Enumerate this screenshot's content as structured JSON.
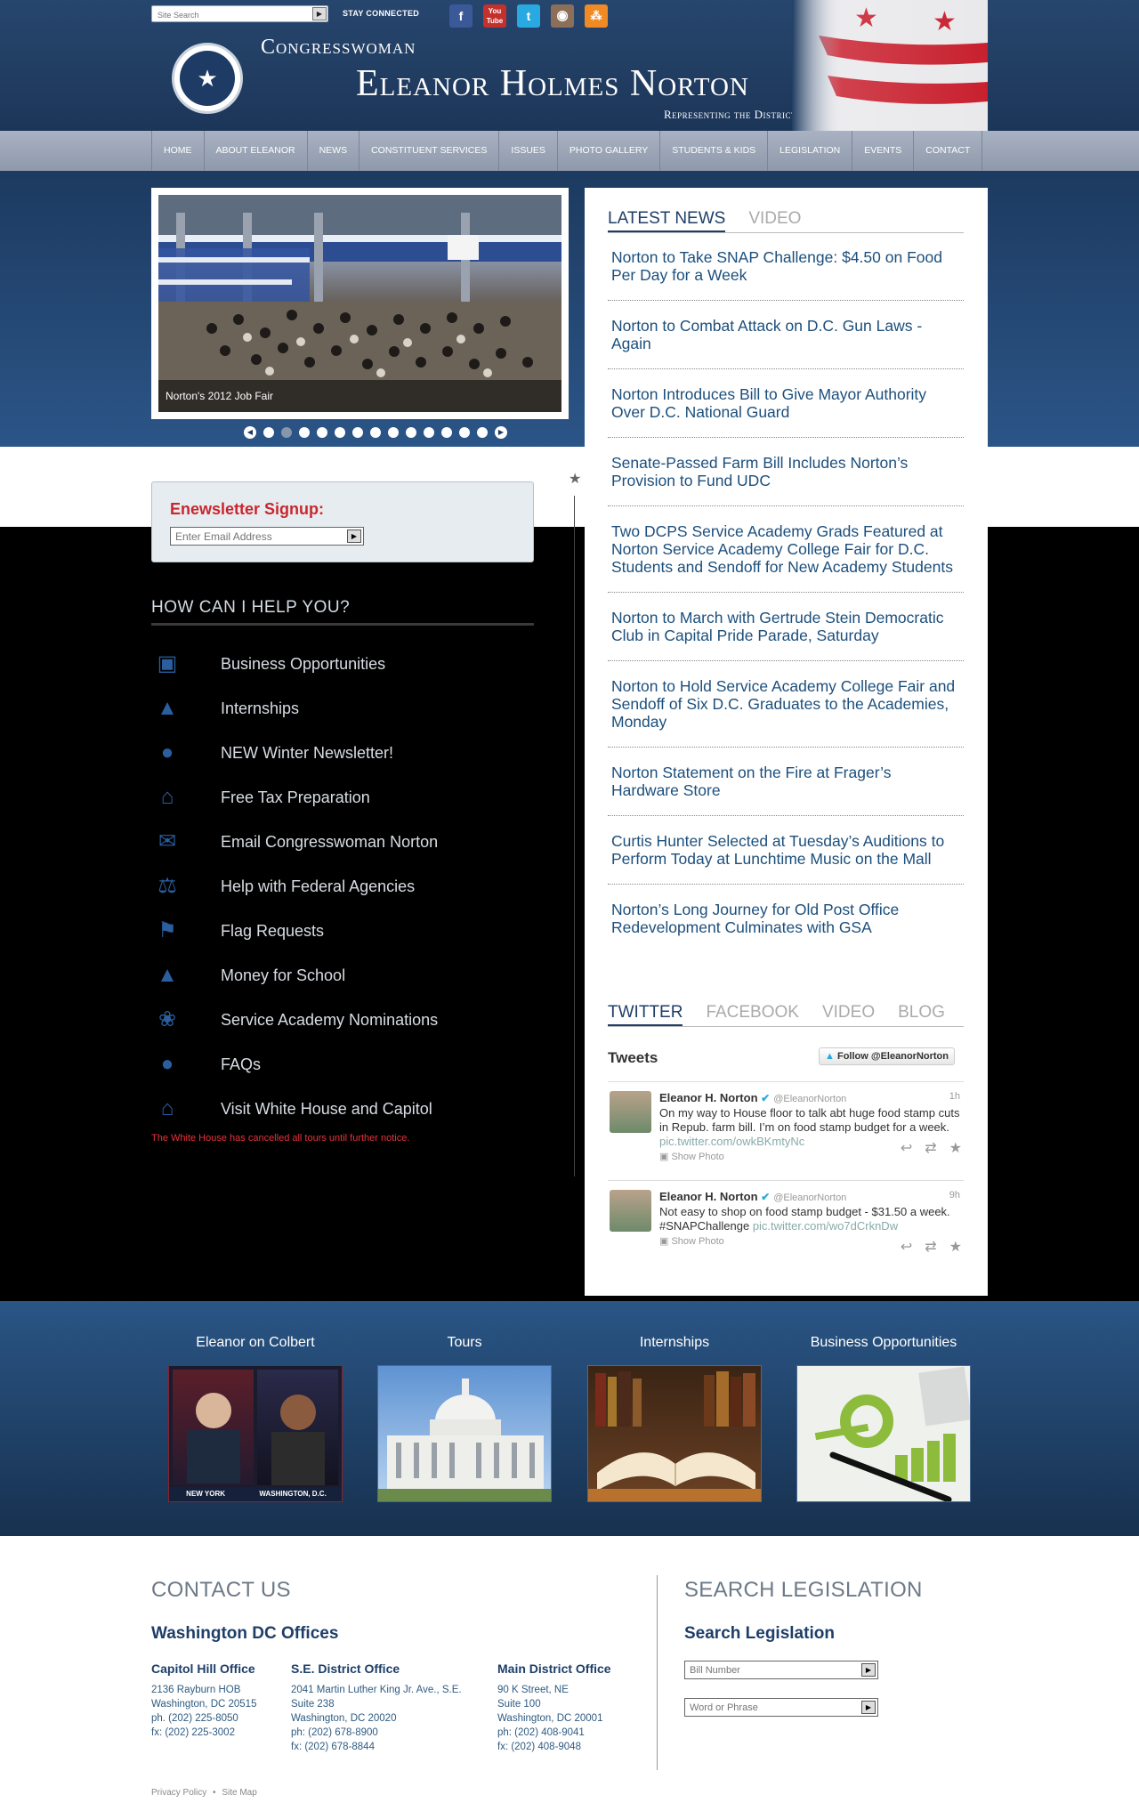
{
  "header": {
    "search_placeholder": "Site Search",
    "stay_connected": "STAY CONNECTED",
    "social_icons": [
      "facebook-icon",
      "youtube-icon",
      "twitter-icon",
      "instagram-icon",
      "rss-icon"
    ],
    "title_top": "Congresswoman",
    "title_main": "Eleanor Holmes Norton",
    "title_sub": "Representing the District of Columbia"
  },
  "nav": [
    "HOME",
    "ABOUT ELEANOR",
    "NEWS",
    "CONSTITUENT SERVICES",
    "ISSUES",
    "PHOTO GALLERY",
    "STUDENTS & KIDS",
    "LEGISLATION",
    "EVENTS",
    "CONTACT"
  ],
  "slider": {
    "caption": "Norton's 2012 Job Fair",
    "dot_count": 13,
    "active_dot": 1
  },
  "newsletter": {
    "title": "Enewsletter Signup:",
    "placeholder": "Enter Email Address"
  },
  "help": {
    "title": "HOW CAN I HELP YOU?",
    "items": [
      {
        "label": "Business Opportunities",
        "icon": "briefcase-icon"
      },
      {
        "label": "Internships",
        "icon": "graduation-cap-icon"
      },
      {
        "label": "NEW Winter Newsletter!",
        "icon": "speech-bubbles-icon"
      },
      {
        "label": "Free Tax Preparation",
        "icon": "capitol-building-icon"
      },
      {
        "label": "Email Congresswoman Norton",
        "icon": "envelope-icon"
      },
      {
        "label": "Help with Federal Agencies",
        "icon": "scales-icon"
      },
      {
        "label": "Flag Requests",
        "icon": "flag-icon"
      },
      {
        "label": "Money for School",
        "icon": "graduation-cap-icon"
      },
      {
        "label": "Service Academy Nominations",
        "icon": "ribbon-icon"
      },
      {
        "label": "FAQs",
        "icon": "speech-bubbles-icon"
      },
      {
        "label": "Visit White House and Capitol",
        "icon": "capitol-building-icon"
      }
    ],
    "tour_note": "The White House has cancelled all tours until further notice."
  },
  "news": {
    "tabs": [
      "LATEST NEWS",
      "VIDEO"
    ],
    "items": [
      "Norton to Take SNAP Challenge: $4.50 on Food Per Day for a Week",
      "Norton to Combat Attack on D.C. Gun Laws - Again",
      "Norton Introduces Bill to Give Mayor Authority Over D.C. National Guard",
      "Senate-Passed Farm Bill Includes Norton’s Provision to Fund UDC",
      "Two DCPS Service Academy Grads Featured at Norton Service Academy College Fair for D.C. Students and Sendoff for New Academy Students",
      "Norton to March with Gertrude Stein Democratic Club in Capital Pride Parade, Saturday",
      "Norton to Hold Service Academy College Fair and Sendoff of Six D.C. Graduates to the Academies, Monday",
      "Norton Statement on the Fire at Frager’s Hardware Store",
      "Curtis Hunter Selected at Tuesday’s Auditions to Perform Today at Lunchtime Music on the Mall",
      "Norton’s Long Journey for Old Post Office Redevelopment Culminates with GSA"
    ]
  },
  "social": {
    "tabs": [
      "TWITTER",
      "FACEBOOK",
      "VIDEO",
      "BLOG"
    ],
    "tweets_title": "Tweets",
    "follow_label": "Follow @EleanorNorton",
    "tweets": [
      {
        "name": "Eleanor H. Norton",
        "handle": "@EleanorNorton",
        "time": "1h",
        "text": "On my way to House floor to talk abt huge food stamp cuts in Repub. farm bill. I’m on food stamp budget for a week.",
        "link": "pic.twitter.com/owkBKmtyNc",
        "show_photo": "Show Photo"
      },
      {
        "name": "Eleanor H. Norton",
        "handle": "@EleanorNorton",
        "time": "9h",
        "text": "Not easy to shop on food stamp budget - $31.50 a week. #SNAPChallenge",
        "link": "pic.twitter.com/wo7dCrknDw",
        "show_photo": "Show Photo"
      }
    ]
  },
  "promo": [
    {
      "label": "Eleanor on Colbert",
      "captions": [
        "NEW YORK",
        "WASHINGTON, D.C."
      ]
    },
    {
      "label": "Tours"
    },
    {
      "label": "Internships"
    },
    {
      "label": "Business Opportunities"
    }
  ],
  "footer": {
    "contact_title": "CONTACT US",
    "offices_title": "Washington DC Offices",
    "offices": [
      {
        "name": "Capitol Hill Office",
        "lines": [
          "2136 Rayburn HOB",
          "Washington, DC 20515",
          "ph. (202) 225-8050",
          "fx: (202) 225-3002"
        ]
      },
      {
        "name": "S.E. District Office",
        "lines": [
          "2041 Martin Luther King Jr. Ave., S.E.",
          "Suite 238",
          "Washington, DC 20020",
          "ph: (202) 678-8900",
          "fx: (202) 678-8844"
        ]
      },
      {
        "name": "Main District Office",
        "lines": [
          "90 K Street, NE",
          "Suite 100",
          "Washington, DC 20001",
          "ph: (202) 408-9041",
          "fx: (202) 408-9048"
        ]
      }
    ],
    "search_title": "SEARCH LEGISLATION",
    "search_sub": "Search Legislation",
    "bill_placeholder": "Bill Number",
    "phrase_placeholder": "Word or Phrase",
    "links": [
      "Privacy Policy",
      "Site Map"
    ]
  }
}
